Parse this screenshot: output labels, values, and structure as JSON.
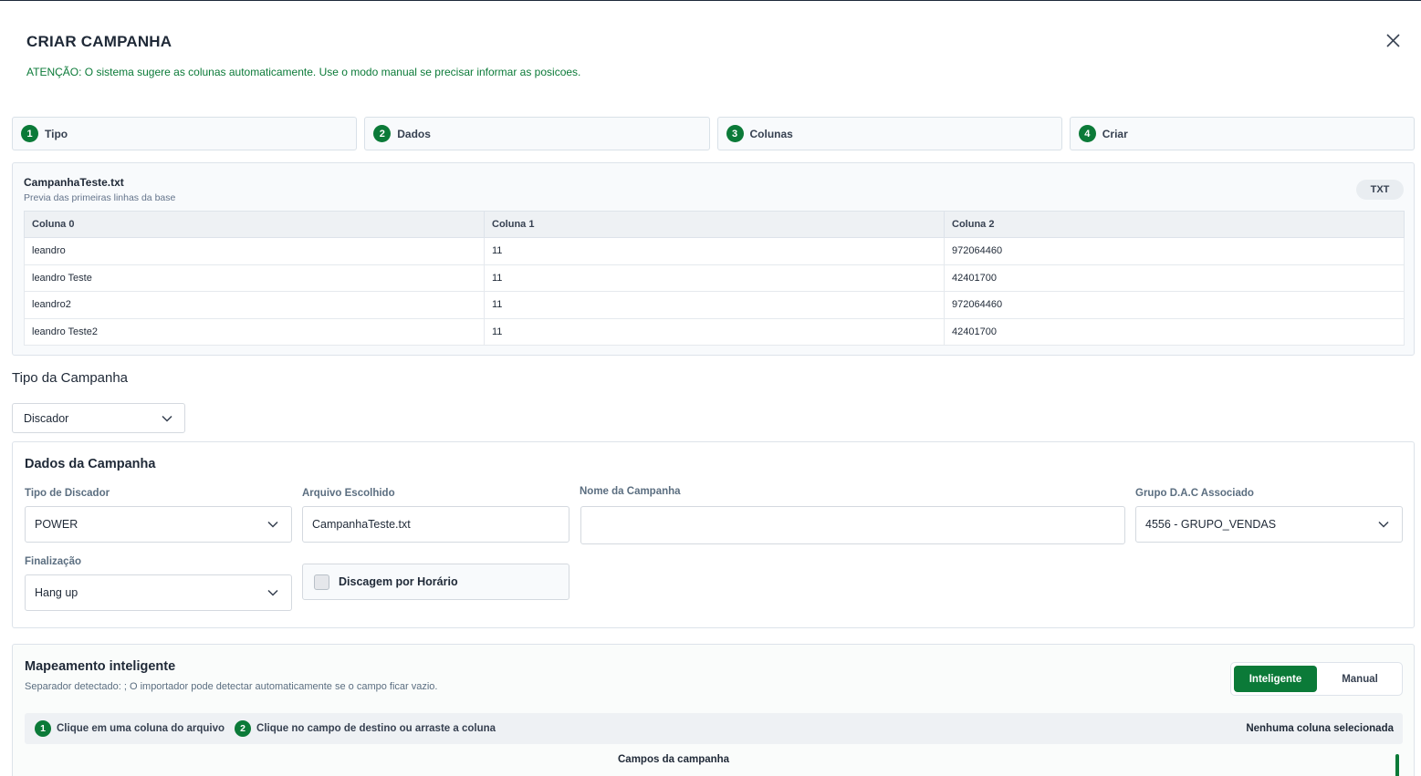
{
  "modal": {
    "title": "CRIAR CAMPANHA",
    "notice": "ATENÇÃO: O sistema sugere as colunas automaticamente. Use o modo manual se precisar informar as posicoes."
  },
  "steps": [
    {
      "num": "1",
      "label": "Tipo"
    },
    {
      "num": "2",
      "label": "Dados"
    },
    {
      "num": "3",
      "label": "Colunas"
    },
    {
      "num": "4",
      "label": "Criar"
    }
  ],
  "preview": {
    "file_name": "CampanhaTeste.txt",
    "subtitle": "Previa das primeiras linhas da base",
    "badge": "TXT",
    "columns": [
      "Coluna 0",
      "Coluna 1",
      "Coluna 2"
    ],
    "rows": [
      [
        "leandro",
        "11",
        "972064460"
      ],
      [
        "leandro Teste",
        "11",
        "42401700"
      ],
      [
        "leandro2",
        "11",
        "972064460"
      ],
      [
        "leandro Teste2",
        "11",
        "42401700"
      ]
    ]
  },
  "tipo_campanha": {
    "label": "Tipo da Campanha",
    "value": "Discador"
  },
  "dados": {
    "title": "Dados da Campanha",
    "tipo_discador": {
      "label": "Tipo de Discador",
      "value": "POWER"
    },
    "arquivo": {
      "label": "Arquivo Escolhido",
      "value": "CampanhaTeste.txt"
    },
    "nome": {
      "label": "Nome da Campanha",
      "value": ""
    },
    "grupo": {
      "label": "Grupo D.A.C Associado",
      "value": "4556 - GRUPO_VENDAS"
    },
    "finalizacao": {
      "label": "Finalização",
      "value": "Hang up"
    },
    "discagem_horario": {
      "label": "Discagem por Horário"
    }
  },
  "mapeamento": {
    "title": "Mapeamento inteligente",
    "subtitle": "Separador detectado: ;   O importador pode detectar automaticamente se o campo ficar vazio.",
    "toggle_on": "Inteligente",
    "toggle_off": "Manual",
    "hint1_num": "1",
    "hint1": "Clique em uma coluna do arquivo",
    "hint2_num": "2",
    "hint2": "Clique no campo de destino ou arraste a coluna",
    "status": "Nenhuma coluna selecionada",
    "campos_title": "Campos da campanha"
  },
  "colors": {
    "accent": "#0b7a38"
  }
}
